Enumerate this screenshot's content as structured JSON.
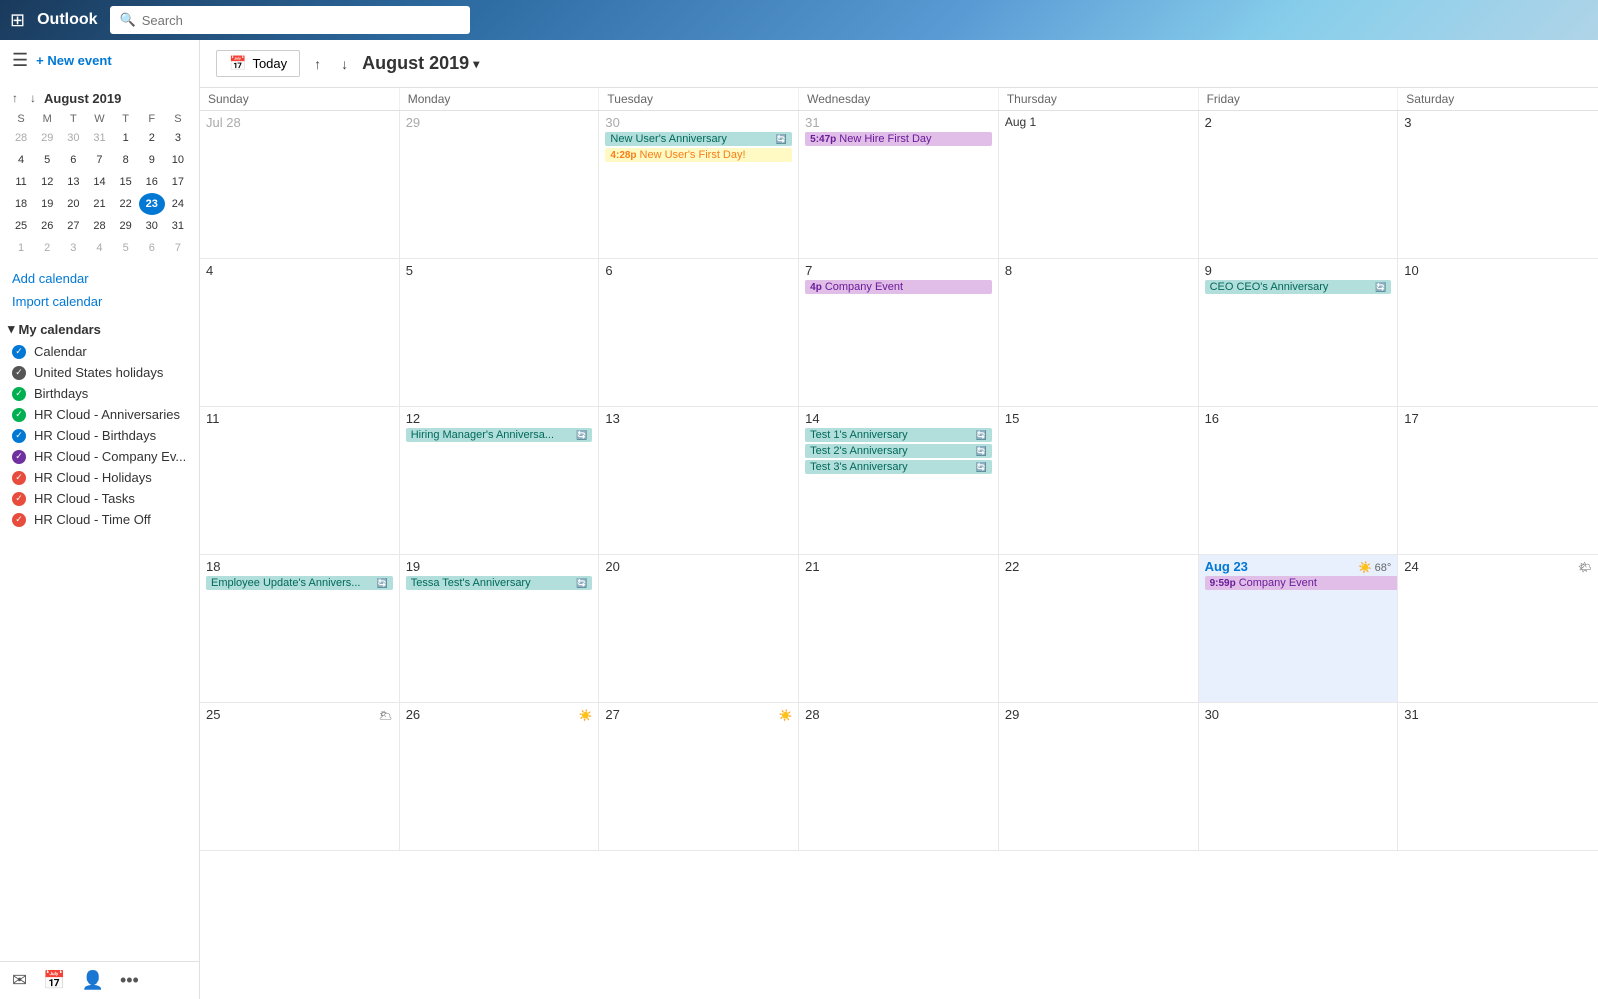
{
  "topbar": {
    "waffle": "⊞",
    "logo": "Outlook",
    "search_placeholder": "Search"
  },
  "sidebar": {
    "hamburger": "☰",
    "new_event_label": "+ New event",
    "mini_calendar_title": "August 2019",
    "mini_cal_prev": "↑",
    "mini_cal_next": "↓",
    "days_of_week": [
      "S",
      "M",
      "T",
      "W",
      "T",
      "F",
      "S"
    ],
    "weeks": [
      [
        "28",
        "29",
        "30",
        "31",
        "1",
        "2",
        "3"
      ],
      [
        "4",
        "5",
        "6",
        "7",
        "8",
        "9",
        "10"
      ],
      [
        "11",
        "12",
        "13",
        "14",
        "15",
        "16",
        "17"
      ],
      [
        "18",
        "19",
        "20",
        "21",
        "22",
        "23",
        "24"
      ],
      [
        "25",
        "26",
        "27",
        "28",
        "29",
        "30",
        "31"
      ],
      [
        "1",
        "2",
        "3",
        "4",
        "5",
        "6",
        "7"
      ]
    ],
    "today_date": "23",
    "add_calendar": "Add calendar",
    "import_calendar": "Import calendar",
    "my_calendars_label": "My calendars",
    "calendars": [
      {
        "name": "Calendar",
        "color": "#0078d4",
        "type": "check"
      },
      {
        "name": "United States holidays",
        "color": "#555",
        "type": "check"
      },
      {
        "name": "Birthdays",
        "color": "#00b050",
        "type": "check"
      },
      {
        "name": "HR Cloud - Anniversaries",
        "color": "#00b050",
        "type": "check"
      },
      {
        "name": "HR Cloud - Birthdays",
        "color": "#0078d4",
        "type": "check"
      },
      {
        "name": "HR Cloud - Company Ev...",
        "color": "#7030a0",
        "type": "check"
      },
      {
        "name": "HR Cloud - Holidays",
        "color": "#ff0000",
        "type": "check"
      },
      {
        "name": "HR Cloud - Tasks",
        "color": "#ff0000",
        "type": "check"
      },
      {
        "name": "HR Cloud - Time Off",
        "color": "#ff0000",
        "type": "check"
      }
    ]
  },
  "calendar": {
    "today_btn": "Today",
    "month_title": "August 2019",
    "day_headers": [
      "Sunday",
      "Monday",
      "Tuesday",
      "Wednesday",
      "Thursday",
      "Friday",
      "Saturday"
    ],
    "weeks": [
      {
        "days": [
          {
            "date": "Jul 28",
            "other_month": true,
            "events": []
          },
          {
            "date": "29",
            "other_month": true,
            "events": []
          },
          {
            "date": "30",
            "other_month": true,
            "events": [
              {
                "label": "New User's Anniversary",
                "type": "teal",
                "sync": true
              },
              {
                "label": "4:28p New User's First Day!",
                "type": "yellow",
                "time": "4:28p",
                "event_name": "New User's First Day!"
              }
            ]
          },
          {
            "date": "31",
            "other_month": true,
            "events": [
              {
                "label": "5:47p New Hire First Day",
                "type": "purple",
                "time": "5:47p",
                "event_name": "New Hire First Day"
              }
            ]
          },
          {
            "date": "Aug 1",
            "aug_label": true,
            "events": []
          },
          {
            "date": "2",
            "events": []
          },
          {
            "date": "3",
            "events": []
          }
        ]
      },
      {
        "days": [
          {
            "date": "4",
            "events": []
          },
          {
            "date": "5",
            "events": []
          },
          {
            "date": "6",
            "events": []
          },
          {
            "date": "7",
            "events": [
              {
                "label": "4p Company Event",
                "type": "purple",
                "time": "4p",
                "event_name": "Company Event"
              }
            ]
          },
          {
            "date": "8",
            "events": []
          },
          {
            "date": "9",
            "events": [
              {
                "label": "CEO CEO's Anniversary",
                "type": "teal",
                "sync": true
              }
            ]
          },
          {
            "date": "10",
            "events": []
          }
        ]
      },
      {
        "days": [
          {
            "date": "11",
            "events": []
          },
          {
            "date": "12",
            "events": [
              {
                "label": "Hiring Manager's Anniversa...",
                "type": "teal",
                "sync": true
              }
            ]
          },
          {
            "date": "13",
            "events": []
          },
          {
            "date": "14",
            "events": [
              {
                "label": "Test 1's Anniversary",
                "type": "teal",
                "sync": true
              },
              {
                "label": "Test 2's Anniversary",
                "type": "teal",
                "sync": true
              },
              {
                "label": "Test 3's Anniversary",
                "type": "teal",
                "sync": true
              }
            ]
          },
          {
            "date": "15",
            "events": []
          },
          {
            "date": "16",
            "events": []
          },
          {
            "date": "17",
            "events": []
          }
        ]
      },
      {
        "days": [
          {
            "date": "18",
            "events": [
              {
                "label": "Employee Update's Annivers...",
                "type": "teal",
                "sync": true
              }
            ]
          },
          {
            "date": "19",
            "events": [
              {
                "label": "Tessa Test's Anniversary",
                "type": "teal",
                "sync": true
              }
            ]
          },
          {
            "date": "20",
            "events": []
          },
          {
            "date": "21",
            "events": []
          },
          {
            "date": "22",
            "events": []
          },
          {
            "date": "23",
            "today": true,
            "weather": "68°",
            "weather_icon": "☀️",
            "events": [
              {
                "label": "9:59p Company Event",
                "type": "purple",
                "time": "9:59p",
                "event_name": "Company Event",
                "multiday": true
              }
            ]
          },
          {
            "date": "24",
            "weather": "🌤",
            "events": []
          }
        ]
      },
      {
        "days": [
          {
            "date": "25",
            "weather": "🌥",
            "events": []
          },
          {
            "date": "26",
            "weather": "☀️",
            "events": []
          },
          {
            "date": "27",
            "weather": "☀️",
            "events": []
          },
          {
            "date": "28",
            "events": []
          },
          {
            "date": "29",
            "events": []
          },
          {
            "date": "30",
            "events": []
          },
          {
            "date": "31",
            "events": []
          }
        ]
      }
    ]
  }
}
